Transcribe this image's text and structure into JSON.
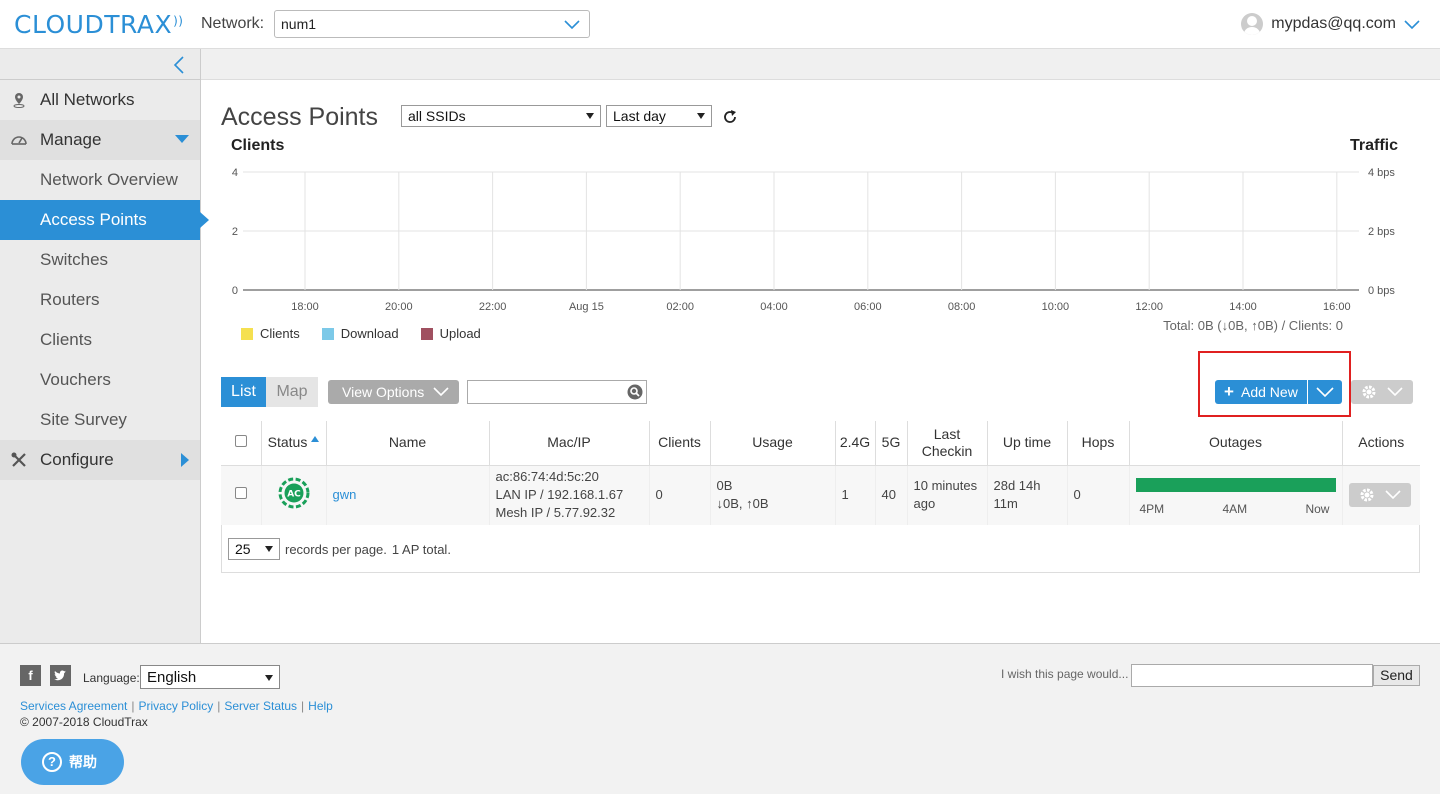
{
  "header": {
    "logo": "CLOUDTRAX",
    "network_label": "Network:",
    "network_value": "num1",
    "user_email": "mypdas@qq.com"
  },
  "sidebar": {
    "items": [
      {
        "label": "All Networks",
        "icon": "location-pin-icon"
      },
      {
        "label": "Manage",
        "icon": "dashboard-gauge-icon"
      },
      {
        "label": "Network Overview"
      },
      {
        "label": "Access Points"
      },
      {
        "label": "Switches"
      },
      {
        "label": "Routers"
      },
      {
        "label": "Clients"
      },
      {
        "label": "Vouchers"
      },
      {
        "label": "Site Survey"
      },
      {
        "label": "Configure",
        "icon": "wrench-screwdriver-icon"
      }
    ]
  },
  "page": {
    "title": "Access Points",
    "ssid_filter": "all SSIDs",
    "time_filter": "Last day"
  },
  "chart_data": {
    "type": "line",
    "title": "",
    "left_label": "Clients",
    "right_label": "Traffic",
    "x_ticks": [
      "18:00",
      "20:00",
      "22:00",
      "Aug 15",
      "02:00",
      "04:00",
      "06:00",
      "08:00",
      "10:00",
      "12:00",
      "14:00",
      "16:00"
    ],
    "y_left_ticks": [
      "4",
      "2",
      "0"
    ],
    "y_right_ticks": [
      "4 bps",
      "2 bps",
      "0 bps"
    ],
    "ylim": [
      0,
      4
    ],
    "grid": true,
    "legend_position": "bottom-left",
    "series": [
      {
        "name": "Clients",
        "color": "#f5e050",
        "values": []
      },
      {
        "name": "Download",
        "color": "#7cc9e8",
        "values": []
      },
      {
        "name": "Upload",
        "color": "#a05060",
        "values": []
      }
    ],
    "totals": "Total: 0B (↓0B, ↑0B) / Clients: 0"
  },
  "toolbar": {
    "list_tab": "List",
    "map_tab": "Map",
    "view_options": "View Options",
    "search_placeholder": "",
    "add_new": "Add New"
  },
  "table": {
    "headers": [
      "Status",
      "Name",
      "Mac/IP",
      "Clients",
      "Usage",
      "2.4G",
      "5G",
      "Last Checkin",
      "Up time",
      "Hops",
      "Outages",
      "Actions"
    ],
    "rows": [
      {
        "name": "gwn",
        "mac": "ac:86:74:4d:5c:20",
        "lan_ip": "LAN IP / 192.168.1.67",
        "mesh_ip": "Mesh IP / 5.77.92.32",
        "clients": "0",
        "usage_total": "0B",
        "usage_detail": "↓0B, ↑0B",
        "ch24": "1",
        "ch5": "40",
        "last_checkin": "10 minutes ago",
        "uptime": "28d 14h 11m",
        "hops": "0",
        "outage_labels": [
          "4PM",
          "4AM",
          "Now"
        ],
        "outage_color": "#1aa05a",
        "outage_up_fraction": 1.0
      }
    ],
    "per_page": "25",
    "per_page_label": "records per page.",
    "total_label": "1 AP total."
  },
  "footer": {
    "language_label": "Language:",
    "language_value": "English",
    "links": [
      "Services Agreement",
      "Privacy Policy",
      "Server Status",
      "Help"
    ],
    "copyright": "© 2007-2018 CloudTrax",
    "feedback_label": "I wish this page would...",
    "send_label": "Send",
    "help_button": "帮助"
  },
  "colors": {
    "brand": "#2b8fd6",
    "outage_ok": "#1aa05a",
    "highlight_box": "#e02020"
  }
}
